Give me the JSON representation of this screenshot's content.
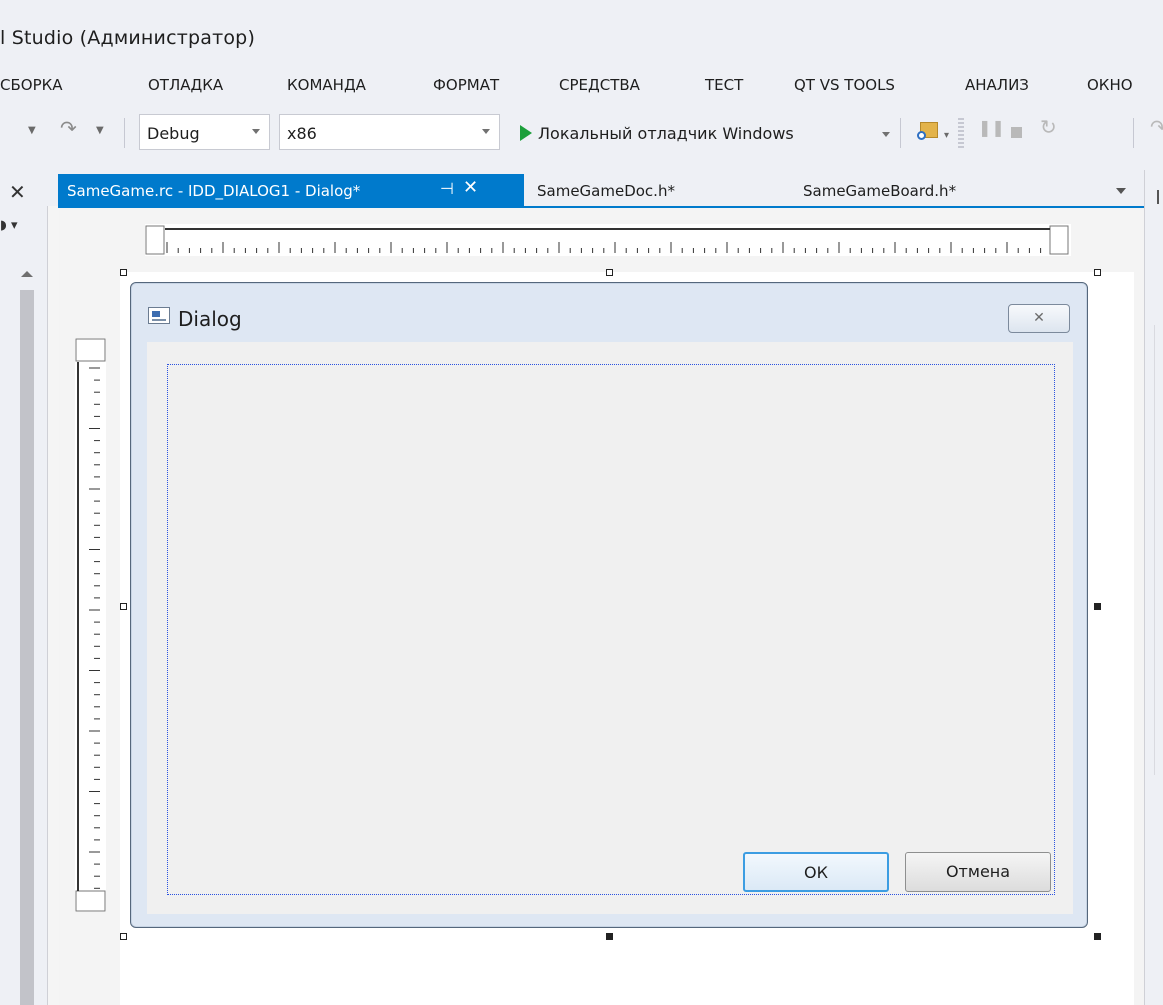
{
  "window": {
    "title": "l Studio  (Администратор)"
  },
  "menu": {
    "items": [
      "СБОРКА",
      "ОТЛАДКА",
      "КОМАНДА",
      "ФОРМАТ",
      "СРЕДСТВА",
      "ТЕСТ",
      "QT VS TOOLS",
      "АНАЛИЗ",
      "ОКНО"
    ]
  },
  "toolbar": {
    "configuration": "Debug",
    "platform": "x86",
    "run_label": "Локальный отладчик Windows",
    "run_icon": "play-icon",
    "run_color": "#1c9f3b"
  },
  "tabs": {
    "active_label": "SameGame.rc - IDD_DIALOG1 - Dialog*",
    "doc_label": "SameGameDoc.h*",
    "board_label": "SameGameBoard.h*",
    "active_color": "#007acc"
  },
  "dialog": {
    "title": "Dialog",
    "ok_label": "ОК",
    "cancel_label": "Отмена"
  }
}
